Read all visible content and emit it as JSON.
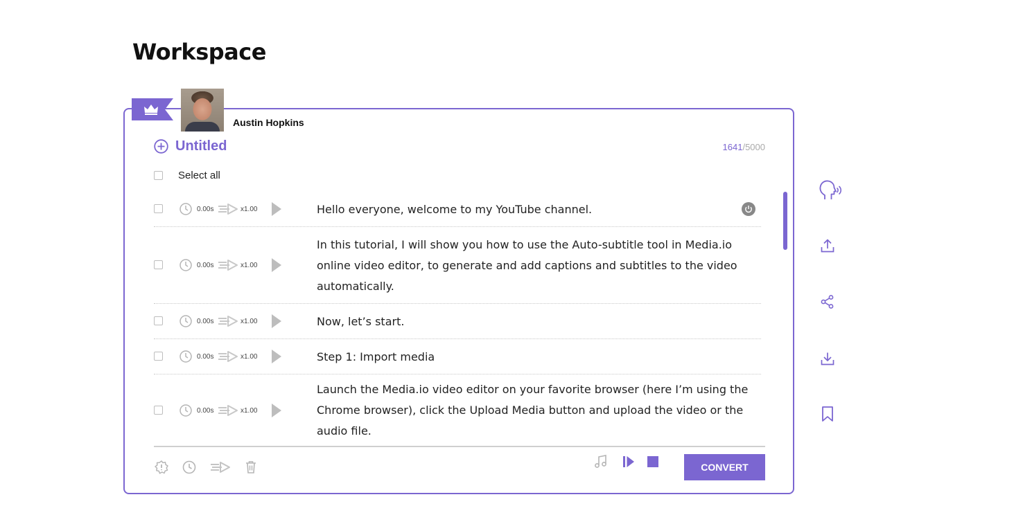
{
  "page": {
    "title": "Workspace"
  },
  "user": {
    "name": "Austin Hopkins"
  },
  "document": {
    "title": "Untitled",
    "char_count_used": "1641",
    "char_count_sep": "/",
    "char_count_max": "5000",
    "select_all_label": "Select all"
  },
  "rows": [
    {
      "time": "0.00s",
      "speed": "x1.00",
      "text": "Hello everyone, welcome to my YouTube channel."
    },
    {
      "time": "0.00s",
      "speed": "x1.00",
      "text": "In this tutorial, I will show you how to use the Auto-subtitle tool in Media.io online video editor, to generate and add captions and subtitles to the video automatically."
    },
    {
      "time": "0.00s",
      "speed": "x1.00",
      "text": "Now, let’s start."
    },
    {
      "time": "0.00s",
      "speed": "x1.00",
      "text": "Step 1: Import media"
    },
    {
      "time": "0.00s",
      "speed": "x1.00",
      "text": "Launch the Media.io video editor on your favorite browser (here I’m using the Chrome browser), click the Upload Media button and upload the video or the audio file."
    }
  ],
  "footer": {
    "convert_label": "CONVERT"
  },
  "colors": {
    "accent": "#7b66d1",
    "icon_gray": "#b5b5b5",
    "text": "#222222"
  },
  "icons": {
    "ribbon": "crown-icon",
    "header": "add-circle-icon",
    "row": [
      "clock-icon",
      "speed-arrow-icon",
      "play-icon",
      "power-icon"
    ],
    "footer": [
      "settings-icon",
      "clock-icon",
      "speed-arrow-icon",
      "trash-icon",
      "music-note-icon",
      "play-step-icon",
      "stop-icon"
    ],
    "side": [
      "voice-icon",
      "upload-icon",
      "share-icon",
      "download-icon",
      "bookmark-icon"
    ]
  }
}
